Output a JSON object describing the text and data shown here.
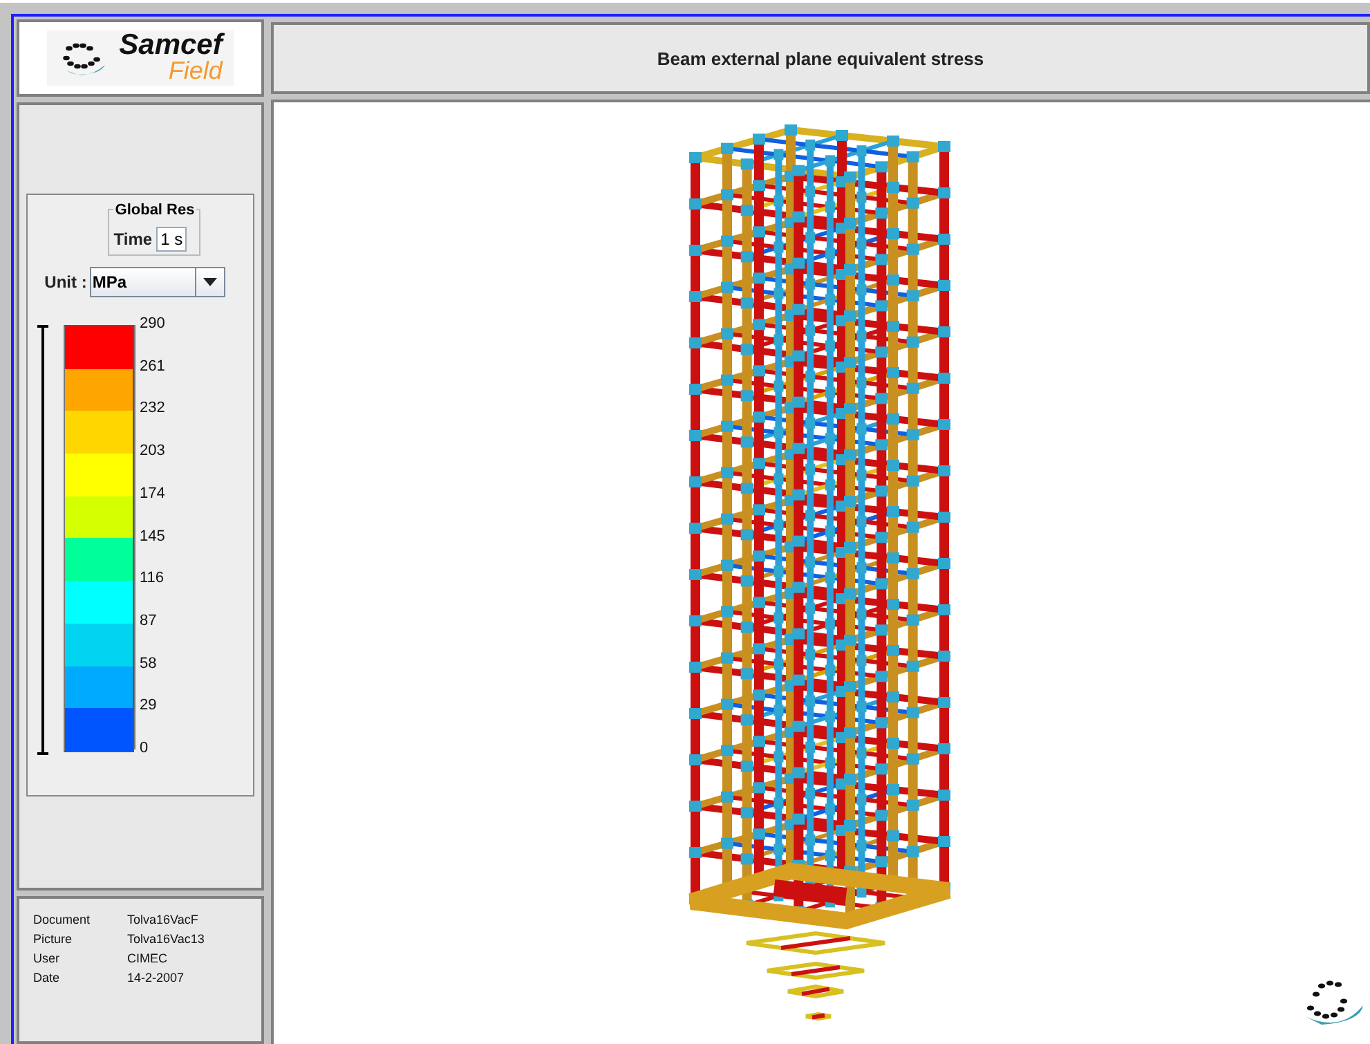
{
  "logo": {
    "name": "Samcef",
    "product": "Field"
  },
  "title": "Beam external plane equivalent stress",
  "legend": {
    "group_label": "Global Res",
    "time_label": "Time",
    "time_value": "1 s",
    "unit_label": "Unit :",
    "unit_value": "MPa",
    "bands": [
      {
        "color": "#ff0000"
      },
      {
        "color": "#ffa500"
      },
      {
        "color": "#ffd700"
      },
      {
        "color": "#ffff00"
      },
      {
        "color": "#d4ff00"
      },
      {
        "color": "#00ff99"
      },
      {
        "color": "#00ffff"
      },
      {
        "color": "#00d4f0"
      },
      {
        "color": "#00aaff"
      },
      {
        "color": "#0055ff"
      }
    ],
    "ticks": [
      "290",
      "261",
      "232",
      "203",
      "174",
      "145",
      "116",
      "87",
      "58",
      "29",
      "0"
    ]
  },
  "info": [
    {
      "label": "Document",
      "value": "Tolva16VacF"
    },
    {
      "label": "Picture",
      "value": "Tolva16Vac13"
    },
    {
      "label": "User",
      "value": "CIMEC"
    },
    {
      "label": "Date",
      "value": "14-2-2007"
    }
  ]
}
